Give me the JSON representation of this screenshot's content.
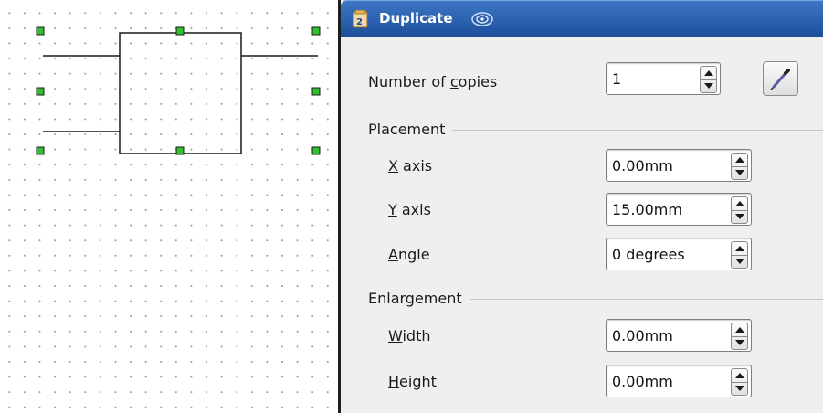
{
  "dialog": {
    "title": "Duplicate",
    "copies": {
      "label_pre": "Number of ",
      "label_key": "c",
      "label_post": "opies",
      "value": "1"
    },
    "placement": {
      "section_title": "Placement",
      "x_axis": {
        "label_key": "X",
        "label_post": " axis",
        "value": "0.00mm"
      },
      "y_axis": {
        "label_key": "Y",
        "label_post": " axis",
        "value": "15.00mm"
      },
      "angle": {
        "label_key": "A",
        "label_post": "ngle",
        "value": "0 degrees"
      }
    },
    "enlargement": {
      "section_title": "Enlargement",
      "width": {
        "label_key": "W",
        "label_post": "idth",
        "value": "0.00mm"
      },
      "height": {
        "label_key": "H",
        "label_post": "eight",
        "value": "0.00mm"
      }
    },
    "icons": {
      "title": "app-document-icon",
      "deco": "swirl-icon",
      "picker": "color-picker-icon"
    }
  },
  "colors": {
    "titlebar": "#2a5fae",
    "handle": "#2fbf2f"
  }
}
